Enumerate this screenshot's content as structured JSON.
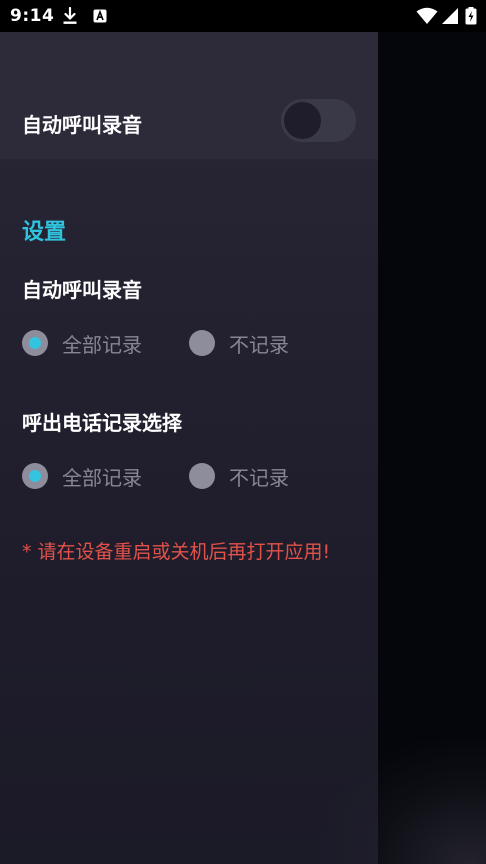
{
  "status_bar": {
    "time": "9:14",
    "icons": [
      "download-icon",
      "a-icon",
      "wifi-icon",
      "signal-icon",
      "battery-charging-icon"
    ]
  },
  "settings": {
    "auto_record_toggle": {
      "label": "自动呼叫录音",
      "enabled": false
    },
    "section_heading": "设置",
    "groups": [
      {
        "title": "自动呼叫录音",
        "options": [
          {
            "label": "全部记录",
            "selected": true
          },
          {
            "label": "不记录",
            "selected": false
          }
        ]
      },
      {
        "title": "呼出电话记录选择",
        "options": [
          {
            "label": "全部记录",
            "selected": true
          },
          {
            "label": "不记录",
            "selected": false
          }
        ]
      }
    ],
    "warning": "* 请在设备重启或关机后再打开应用!"
  },
  "colors": {
    "accent": "#2fc3de",
    "warning": "#e2524a",
    "panel_background": "#242230",
    "backdrop": "#05060b"
  }
}
